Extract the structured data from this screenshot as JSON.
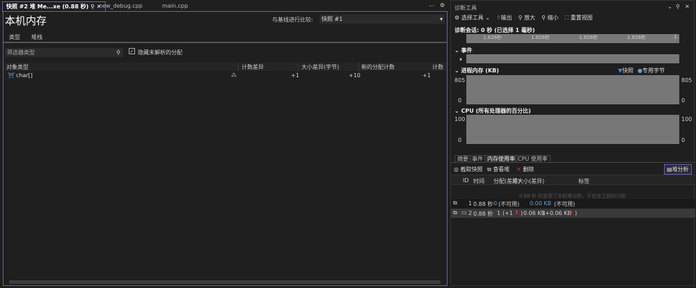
{
  "tabs": [
    {
      "label": "快照 #2 堆 Me...xe (0.88 秒)",
      "active": true
    },
    {
      "label": "new_debug.cpp"
    },
    {
      "label": "main.cpp"
    }
  ],
  "left": {
    "title": "本机内存",
    "compare_label": "与基线进行比较:",
    "compare_value": "快照 #1",
    "subtabs": [
      "类型",
      "堆栈"
    ],
    "filter_placeholder": "筛选器类型",
    "hide_unresolved": "隐藏未解析的分配",
    "hide_unresolved_checked": true,
    "columns": [
      "对象类型",
      "计数差异",
      "大小差异(字节)",
      "新的分配计数",
      "计数"
    ],
    "rows": [
      {
        "type": "char[]",
        "count_diff": "+1",
        "size_diff": "+10",
        "new_alloc": "+1"
      }
    ]
  },
  "right": {
    "title": "诊断工具",
    "toolbar": [
      "选择工具",
      "输出",
      "放大",
      "缩小",
      "重置视图"
    ],
    "session": "诊断会话: 0 秒 (已选择 1 毫秒)",
    "ruler": [
      "1.826秒",
      "1.826秒",
      "1.826秒",
      "1.826秒",
      "1."
    ],
    "events_label": "事件",
    "memory_label": "进程内存 (KB)",
    "legend": [
      "快照",
      "专用字节"
    ],
    "memory_max": "805",
    "memory_min": "0",
    "cpu_label": "CPU (所有处理器的百分比)",
    "cpu_max": "100",
    "cpu_min": "0",
    "bottom_tabs": [
      "摘要",
      "事件",
      "内存使用率",
      "CPU 使用率"
    ],
    "active_bottom_tab": "内存使用率",
    "actions": [
      "截取快照",
      "查看堆",
      "删除"
    ],
    "heap_button": "堆分析",
    "table_columns": [
      "ID",
      "时间",
      "分配(差异)",
      "堆大小(差异)",
      "标签"
    ],
    "notice": "0.88 秒 时启用了本机堆分析。不包含之前的分配",
    "snapshots": [
      {
        "id": "1",
        "time": "0.88 秒",
        "alloc": "0",
        "alloc_diff": "(不可用)",
        "heap": "0.00 KB",
        "heap_diff": "(不可用)"
      },
      {
        "id": "2",
        "time": "0.88 秒",
        "alloc": "1",
        "alloc_diff": "(+1",
        "heap": "0.06 KB",
        "heap_diff": "(+0.06 KB"
      }
    ],
    "accent": "#6c5fb0",
    "up_color": "#e03030",
    "legend_snapshot_color": "#3c8ce0",
    "legend_bytes_color": "#5aa0d8"
  }
}
